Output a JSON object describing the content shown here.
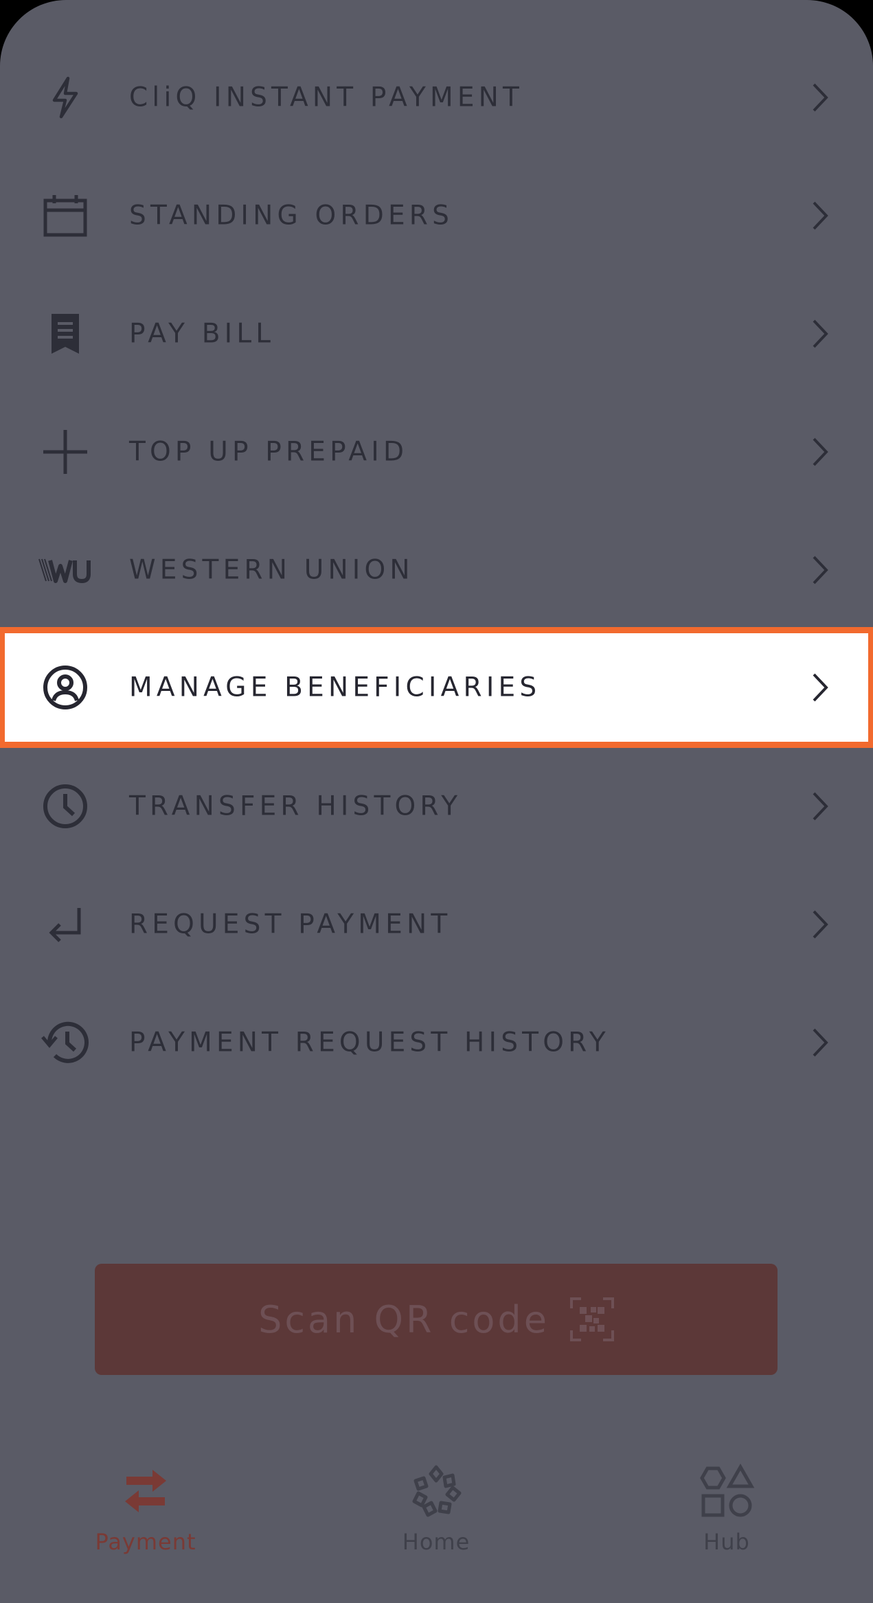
{
  "menu": {
    "items": [
      {
        "label": "CliQ INSTANT PAYMENT",
        "icon": "lightning-icon"
      },
      {
        "label": "STANDING ORDERS",
        "icon": "calendar-icon"
      },
      {
        "label": "PAY BILL",
        "icon": "receipt-icon"
      },
      {
        "label": "TOP UP PREPAID",
        "icon": "plus-icon"
      },
      {
        "label": "WESTERN UNION",
        "icon": "western-union-logo",
        "logo_text": "\\\\WU"
      },
      {
        "label": "MANAGE BENEFICIARIES",
        "icon": "user-circle-icon",
        "highlighted": true
      },
      {
        "label": "TRANSFER HISTORY",
        "icon": "clock-icon"
      },
      {
        "label": "REQUEST PAYMENT",
        "icon": "return-arrow-icon"
      },
      {
        "label": "PAYMENT REQUEST HISTORY",
        "icon": "history-icon"
      }
    ]
  },
  "scan_button": {
    "label": "Scan QR code",
    "icon": "qr-code-icon"
  },
  "tabbar": {
    "tabs": [
      {
        "label": "Payment",
        "icon": "transfer-arrows-icon",
        "active": true
      },
      {
        "label": "Home",
        "icon": "home-logo-icon",
        "active": false
      },
      {
        "label": "Hub",
        "icon": "shapes-icon",
        "active": false
      }
    ]
  },
  "colors": {
    "overlay": "#5a5b66",
    "text": "#2d2e38",
    "highlight_border": "#f26a2e",
    "accent_dim": "#5c3838",
    "active_tab": "#7a3a35",
    "inactive_tab": "#3f404a"
  }
}
